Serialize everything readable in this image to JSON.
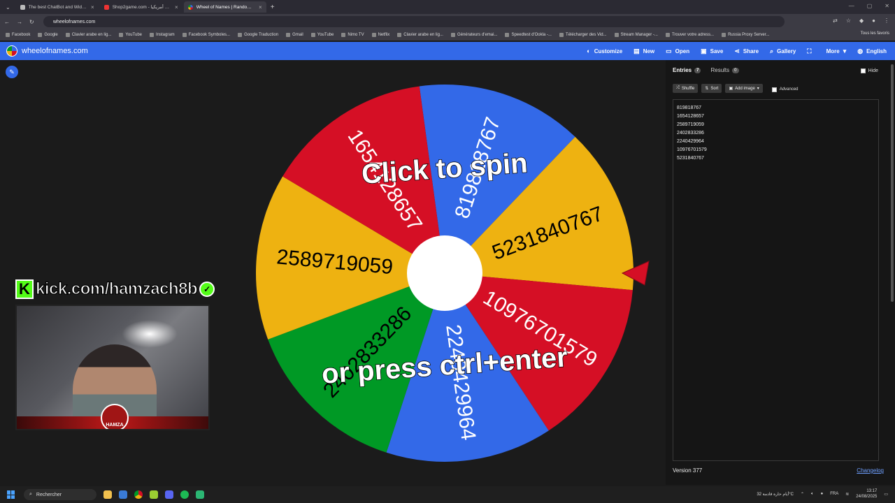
{
  "browser": {
    "tabs": [
      {
        "title": "The best ChatBot and Widgets",
        "active": false
      },
      {
        "title": "Shop2game.com - أسال أمريكيا",
        "active": false
      },
      {
        "title": "Wheel of Names | Random nam",
        "active": true
      }
    ],
    "url": "wheelofnames.com",
    "bookmarks": [
      "Facebook",
      "Google",
      "Clavier arabe en lig...",
      "YouTube",
      "Instagram",
      "Facebook Symboles...",
      "Google Traduction",
      "Gmail",
      "YouTube",
      "Nimo TV",
      "Netflix",
      "Clavier arabe en lig...",
      "Générateurs d'emai...",
      "Speedtest d'Ookla -...",
      "Télécharger des Vid...",
      "Stream Manager -...",
      "Trouver votre adress...",
      "Russia Proxy Server..."
    ],
    "bookmarks_all": "Tous les favoris"
  },
  "app": {
    "title": "wheelofnames.com",
    "menu": [
      {
        "label": "Customize",
        "icon": "palette-icon"
      },
      {
        "label": "New",
        "icon": "file-icon"
      },
      {
        "label": "Open",
        "icon": "folder-icon"
      },
      {
        "label": "Save",
        "icon": "save-icon"
      },
      {
        "label": "Share",
        "icon": "share-icon"
      },
      {
        "label": "Gallery",
        "icon": "search-icon"
      },
      {
        "label": "",
        "icon": "fullscreen-icon"
      },
      {
        "label": "More",
        "icon": "chevron-down-icon"
      },
      {
        "label": "English",
        "icon": "globe-icon"
      }
    ]
  },
  "wheel": {
    "segments": [
      {
        "label": "819818767",
        "color": "#3369e8"
      },
      {
        "label": "5231840767",
        "color": "#eeb211"
      },
      {
        "label": "10976701579",
        "color": "#d50f25"
      },
      {
        "label": "2240429964",
        "color": "#3369e8"
      },
      {
        "label": "2402833286",
        "color": "#009925"
      },
      {
        "label": "2589719059",
        "color": "#eeb211"
      },
      {
        "label": "1654128657",
        "color": "#d50f25"
      }
    ],
    "prompt_top": "Click to spin",
    "prompt_bottom": "or press ctrl+enter"
  },
  "panel": {
    "tabs": [
      {
        "label": "Entries",
        "count": "7"
      },
      {
        "label": "Results",
        "count": "0"
      }
    ],
    "hide_label": "Hide",
    "tools": [
      "Shuffle",
      "Sort",
      "Add image"
    ],
    "advanced_label": "Advanced",
    "entries": [
      "819818767",
      "1654128657",
      "2589719059",
      "2402833286",
      "2240429964",
      "10976701579",
      "5231840767"
    ],
    "version": "Version 377",
    "changelog": "Changelog"
  },
  "overlay": {
    "kick_text": "kick.com/hamzach8b",
    "badge_text": "HAMZA"
  },
  "taskbar": {
    "search": "Rechercher",
    "weather": "أيام حارة قادمة",
    "temp": "32°C",
    "lang": "FRA",
    "time": "13:17",
    "date": "24/08/2025"
  }
}
